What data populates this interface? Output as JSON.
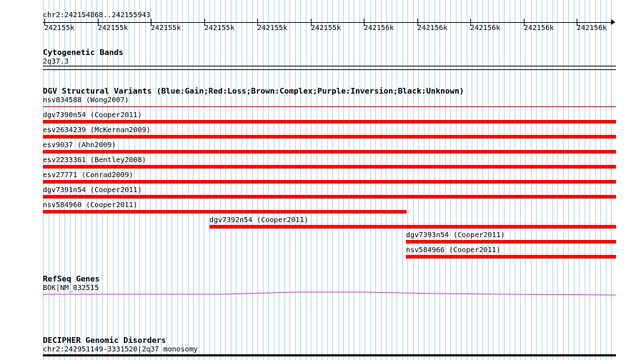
{
  "ruler": {
    "range": "chr2:242154868..242155943",
    "ticks": [
      "242155k",
      "242155k",
      "242155k",
      "242155k",
      "242155k",
      "242155k",
      "242156k",
      "242156k",
      "242156k",
      "242156k",
      "242156k"
    ]
  },
  "cytoband": {
    "title": "Cytogenetic Bands",
    "band": "2q37.3"
  },
  "dgv": {
    "title": "DGV Structural Variants (Blue:Gain;Red:Loss;Brown:Complex;Purple:Inversion;Black:Unknown)",
    "first_label": "nsv834588 (Wong2007)",
    "color": "#ff0000",
    "variants": [
      {
        "label": "dgv7390n54 (Cooper2011)",
        "start": 0.0,
        "end": 1.0
      },
      {
        "label": "esv2634239 (McKernan2009)",
        "start": 0.0,
        "end": 1.0
      },
      {
        "label": "esv9037 (Ahn2009)",
        "start": 0.0,
        "end": 1.0
      },
      {
        "label": "esv2233361 (Bentley2008)",
        "start": 0.0,
        "end": 1.0
      },
      {
        "label": "esv27771 (Conrad2009)",
        "start": 0.0,
        "end": 1.0
      },
      {
        "label": "dgv7391n54 (Cooper2011)",
        "start": 0.0,
        "end": 1.0
      },
      {
        "label": "nsv584960 (Cooper2011)",
        "start": 0.0,
        "end": 0.635
      },
      {
        "label": "dgv7392n54 (Cooper2011)",
        "start": 0.29,
        "end": 1.0
      },
      {
        "label": "dgv7393n54 (Cooper2011)",
        "start": 0.633,
        "end": 1.0
      },
      {
        "label": "nsv584966 (Cooper2011)",
        "start": 0.633,
        "end": 1.0
      }
    ]
  },
  "refseq": {
    "title": "RefSeq Genes",
    "gene": "BOK|NM_032515",
    "color": "#cc33cc"
  },
  "decipher": {
    "title": "DECIPHER Genomic Disorders",
    "region": "chr2:242951149-3331520|2q37 monosomy"
  }
}
